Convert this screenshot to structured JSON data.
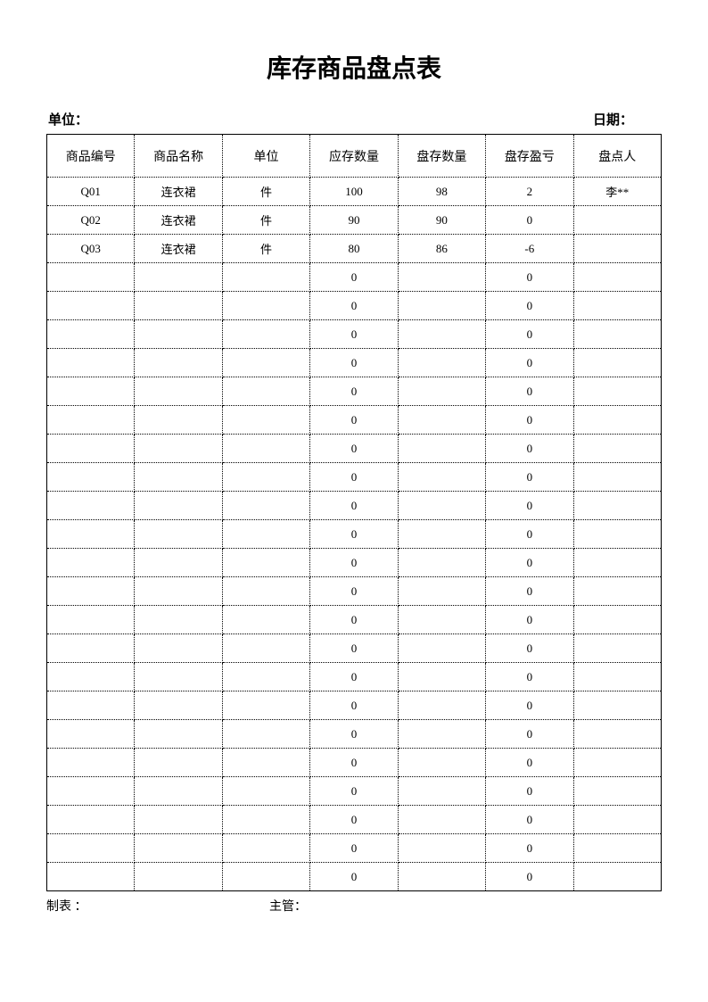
{
  "title": "库存商品盘点表",
  "header": {
    "unit_label": "单位：",
    "date_label": "日期："
  },
  "columns": [
    "商品编号",
    "商品名称",
    "单位",
    "应存数量",
    "盘存数量",
    "盘存盈亏",
    "盘点人"
  ],
  "rows": [
    {
      "code": "Q01",
      "name": "连衣裙",
      "unit": "件",
      "expected": "100",
      "actual": "98",
      "diff": "2",
      "counter": "李**"
    },
    {
      "code": "Q02",
      "name": "连衣裙",
      "unit": "件",
      "expected": "90",
      "actual": "90",
      "diff": "0",
      "counter": ""
    },
    {
      "code": "Q03",
      "name": "连衣裙",
      "unit": "件",
      "expected": "80",
      "actual": "86",
      "diff": "-6",
      "counter": ""
    },
    {
      "code": "",
      "name": "",
      "unit": "",
      "expected": "0",
      "actual": "",
      "diff": "0",
      "counter": ""
    },
    {
      "code": "",
      "name": "",
      "unit": "",
      "expected": "0",
      "actual": "",
      "diff": "0",
      "counter": ""
    },
    {
      "code": "",
      "name": "",
      "unit": "",
      "expected": "0",
      "actual": "",
      "diff": "0",
      "counter": ""
    },
    {
      "code": "",
      "name": "",
      "unit": "",
      "expected": "0",
      "actual": "",
      "diff": "0",
      "counter": ""
    },
    {
      "code": "",
      "name": "",
      "unit": "",
      "expected": "0",
      "actual": "",
      "diff": "0",
      "counter": ""
    },
    {
      "code": "",
      "name": "",
      "unit": "",
      "expected": "0",
      "actual": "",
      "diff": "0",
      "counter": ""
    },
    {
      "code": "",
      "name": "",
      "unit": "",
      "expected": "0",
      "actual": "",
      "diff": "0",
      "counter": ""
    },
    {
      "code": "",
      "name": "",
      "unit": "",
      "expected": "0",
      "actual": "",
      "diff": "0",
      "counter": ""
    },
    {
      "code": "",
      "name": "",
      "unit": "",
      "expected": "0",
      "actual": "",
      "diff": "0",
      "counter": ""
    },
    {
      "code": "",
      "name": "",
      "unit": "",
      "expected": "0",
      "actual": "",
      "diff": "0",
      "counter": ""
    },
    {
      "code": "",
      "name": "",
      "unit": "",
      "expected": "0",
      "actual": "",
      "diff": "0",
      "counter": ""
    },
    {
      "code": "",
      "name": "",
      "unit": "",
      "expected": "0",
      "actual": "",
      "diff": "0",
      "counter": ""
    },
    {
      "code": "",
      "name": "",
      "unit": "",
      "expected": "0",
      "actual": "",
      "diff": "0",
      "counter": ""
    },
    {
      "code": "",
      "name": "",
      "unit": "",
      "expected": "0",
      "actual": "",
      "diff": "0",
      "counter": ""
    },
    {
      "code": "",
      "name": "",
      "unit": "",
      "expected": "0",
      "actual": "",
      "diff": "0",
      "counter": ""
    },
    {
      "code": "",
      "name": "",
      "unit": "",
      "expected": "0",
      "actual": "",
      "diff": "0",
      "counter": ""
    },
    {
      "code": "",
      "name": "",
      "unit": "",
      "expected": "0",
      "actual": "",
      "diff": "0",
      "counter": ""
    },
    {
      "code": "",
      "name": "",
      "unit": "",
      "expected": "0",
      "actual": "",
      "diff": "0",
      "counter": ""
    },
    {
      "code": "",
      "name": "",
      "unit": "",
      "expected": "0",
      "actual": "",
      "diff": "0",
      "counter": ""
    },
    {
      "code": "",
      "name": "",
      "unit": "",
      "expected": "0",
      "actual": "",
      "diff": "0",
      "counter": ""
    },
    {
      "code": "",
      "name": "",
      "unit": "",
      "expected": "0",
      "actual": "",
      "diff": "0",
      "counter": ""
    },
    {
      "code": "",
      "name": "",
      "unit": "",
      "expected": "0",
      "actual": "",
      "diff": "0",
      "counter": ""
    }
  ],
  "footer": {
    "preparer_label": "制表 ：",
    "supervisor_label": "主管："
  }
}
